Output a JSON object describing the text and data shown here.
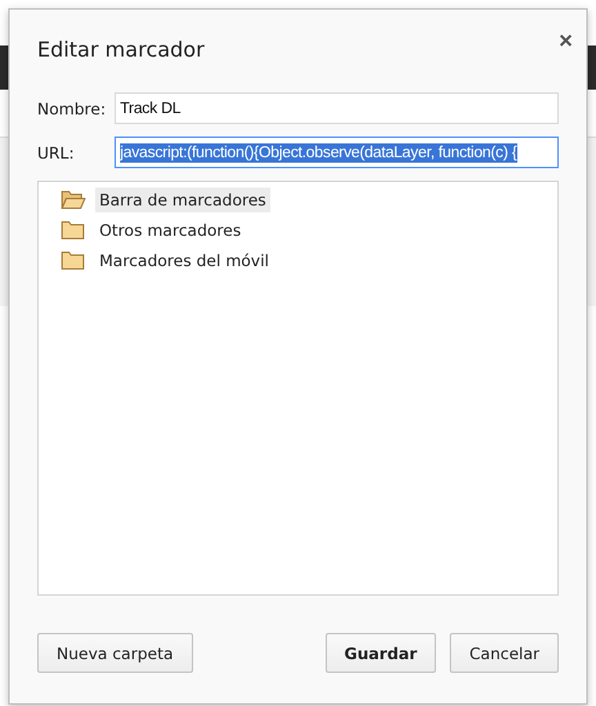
{
  "dialog": {
    "title": "Editar marcador",
    "close": "×"
  },
  "fields": [
    {
      "label": "Nombre:",
      "value": "Track DL",
      "selected": false
    },
    {
      "label": "URL:",
      "value": "javascript:(function(){Object.observe(dataLayer, function(c) {",
      "selected": true
    }
  ],
  "folders": [
    {
      "name": "Barra de marcadores",
      "selected": true
    },
    {
      "name": "Otros marcadores",
      "selected": false
    },
    {
      "name": "Marcadores del móvil",
      "selected": false
    }
  ],
  "buttons": [
    {
      "label": "Nueva carpeta",
      "default": false,
      "kind": "left"
    },
    {
      "label": "Guardar",
      "default": true,
      "kind": "right"
    },
    {
      "label": "Cancelar",
      "default": false,
      "kind": "right"
    }
  ]
}
